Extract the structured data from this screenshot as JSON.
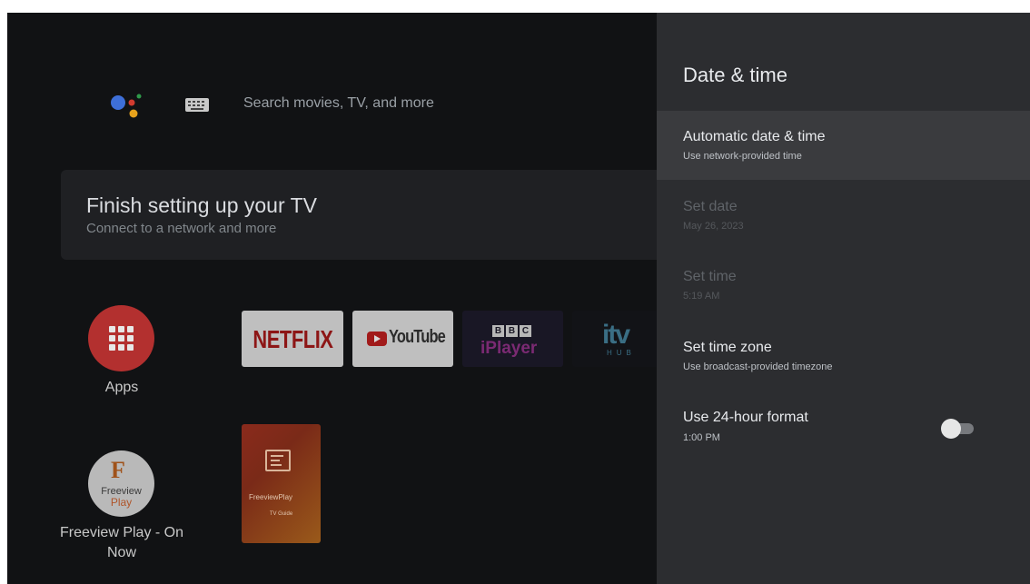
{
  "home": {
    "search_placeholder": "Search movies, TV, and more",
    "setup_card": {
      "title": "Finish setting up your TV",
      "subtitle": "Connect to a network and more"
    },
    "apps_label": "Apps",
    "app_tiles": [
      {
        "name": "NETFLIX"
      },
      {
        "name": "YouTube"
      },
      {
        "name": "BBC iPlayer",
        "blocks": [
          "B",
          "B",
          "C"
        ],
        "text": "iPlayer"
      },
      {
        "name": "itv",
        "sub": "HUB"
      }
    ],
    "freeview": {
      "label": "Freeview Play - On Now",
      "logo_lines": [
        "Freeview",
        "Play"
      ]
    },
    "tv_guide": {
      "brand": "FreeviewPlay",
      "caption": "TV Guide"
    }
  },
  "panel": {
    "title": "Date & time",
    "items": [
      {
        "title": "Automatic date & time",
        "subtitle": "Use network-provided time",
        "enabled": true,
        "selected": true
      },
      {
        "title": "Set date",
        "subtitle": "May 26, 2023",
        "enabled": false
      },
      {
        "title": "Set time",
        "subtitle": "5:19 AM",
        "enabled": false
      },
      {
        "title": "Set time zone",
        "subtitle": "Use broadcast-provided timezone",
        "enabled": true
      },
      {
        "title": "Use 24-hour format",
        "subtitle": "1:00 PM",
        "enabled": true,
        "toggle": false
      }
    ]
  },
  "colors": {
    "apps_red": "#b3302f",
    "panel_bg": "#2c2d30",
    "selected_row": "#3a3b3e"
  },
  "icons": [
    "google-assistant-icon",
    "keyboard-icon",
    "apps-grid-icon",
    "freeview-logo",
    "tv-guide-icon"
  ]
}
